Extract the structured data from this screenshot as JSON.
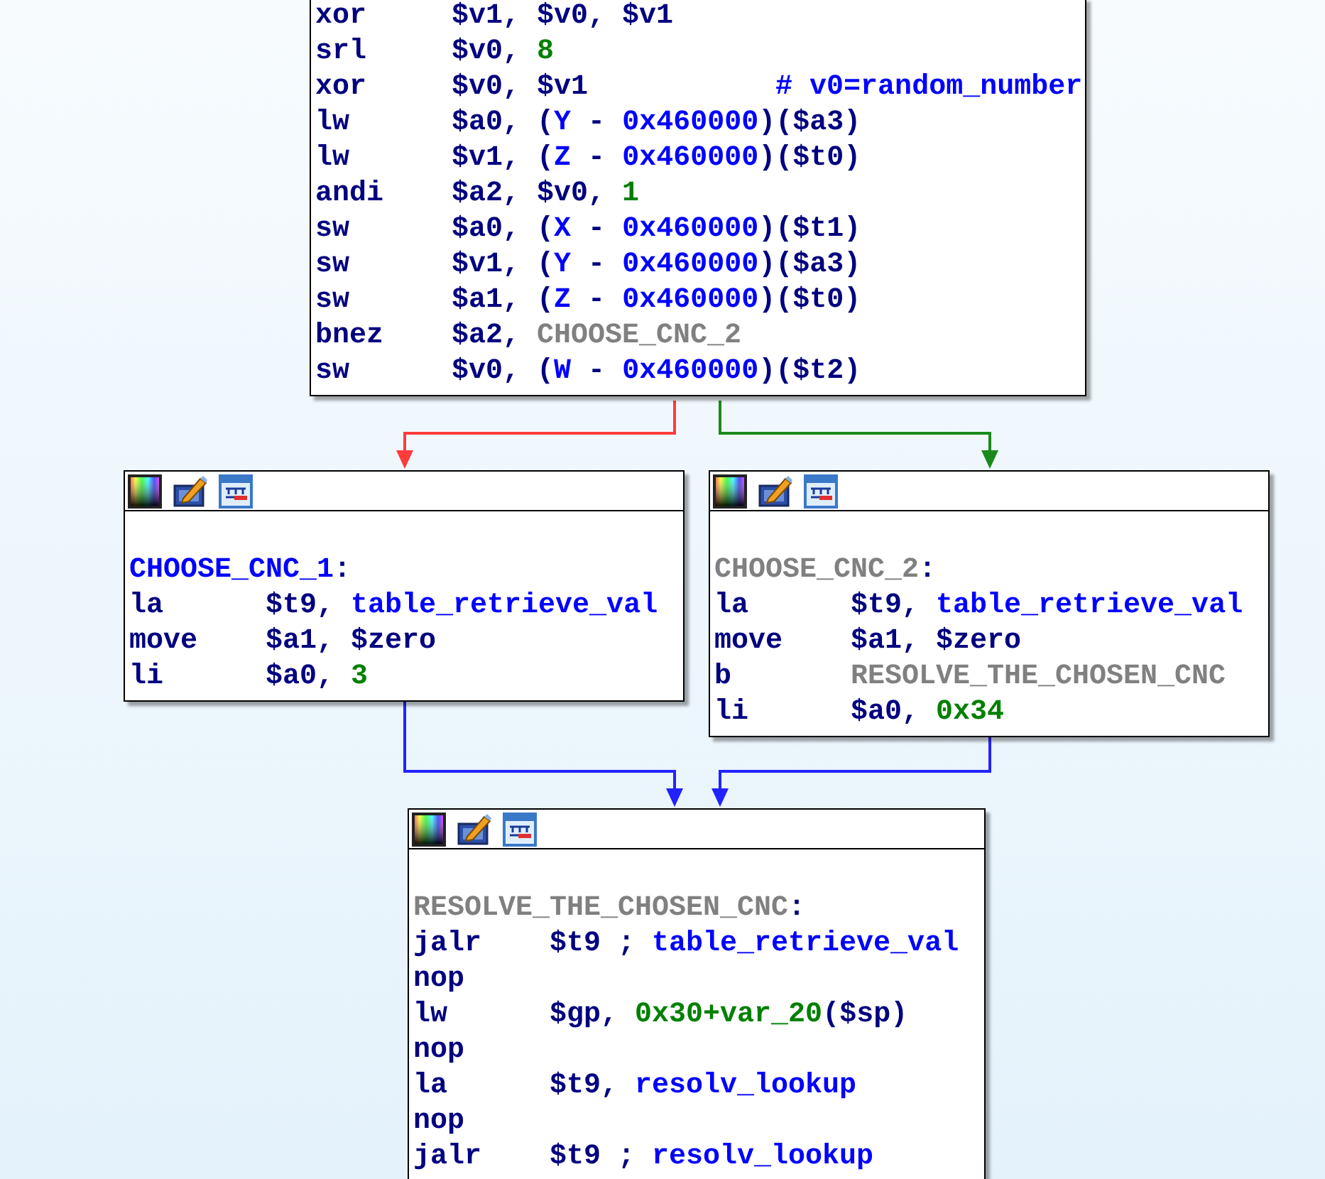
{
  "blocks": [
    {
      "toolbar": false,
      "lines": [
        {
          "op": "xor",
          "tokens": [
            {
              "kind": "reg",
              "text": "$v1, $v0, $v1"
            }
          ]
        },
        {
          "op": "srl",
          "tokens": [
            {
              "kind": "reg",
              "text": "$v0, "
            },
            {
              "kind": "num",
              "text": "8"
            }
          ]
        },
        {
          "op": "xor",
          "tokens": [
            {
              "kind": "reg",
              "text": "$v0, $v1"
            }
          ],
          "comment": "# v0=random_number"
        },
        {
          "op": "lw",
          "tokens": [
            {
              "kind": "reg",
              "text": "$a0, ("
            },
            {
              "kind": "name",
              "text": "Y"
            },
            {
              "kind": "reg",
              "text": " - "
            },
            {
              "kind": "name",
              "text": "0x460000"
            },
            {
              "kind": "reg",
              "text": ")($a3)"
            }
          ]
        },
        {
          "op": "lw",
          "tokens": [
            {
              "kind": "reg",
              "text": "$v1, ("
            },
            {
              "kind": "name",
              "text": "Z"
            },
            {
              "kind": "reg",
              "text": " - "
            },
            {
              "kind": "name",
              "text": "0x460000"
            },
            {
              "kind": "reg",
              "text": ")($t0)"
            }
          ]
        },
        {
          "op": "andi",
          "tokens": [
            {
              "kind": "reg",
              "text": "$a2, $v0, "
            },
            {
              "kind": "num",
              "text": "1"
            }
          ]
        },
        {
          "op": "sw",
          "tokens": [
            {
              "kind": "reg",
              "text": "$a0, ("
            },
            {
              "kind": "name",
              "text": "X"
            },
            {
              "kind": "reg",
              "text": " - "
            },
            {
              "kind": "name",
              "text": "0x460000"
            },
            {
              "kind": "reg",
              "text": ")($t1)"
            }
          ]
        },
        {
          "op": "sw",
          "tokens": [
            {
              "kind": "reg",
              "text": "$v1, ("
            },
            {
              "kind": "name",
              "text": "Y"
            },
            {
              "kind": "reg",
              "text": " - "
            },
            {
              "kind": "name",
              "text": "0x460000"
            },
            {
              "kind": "reg",
              "text": ")($a3)"
            }
          ]
        },
        {
          "op": "sw",
          "tokens": [
            {
              "kind": "reg",
              "text": "$a1, ("
            },
            {
              "kind": "name",
              "text": "Z"
            },
            {
              "kind": "reg",
              "text": " - "
            },
            {
              "kind": "name",
              "text": "0x460000"
            },
            {
              "kind": "reg",
              "text": ")($t0)"
            }
          ]
        },
        {
          "op": "bnez",
          "tokens": [
            {
              "kind": "reg",
              "text": "$a2, "
            },
            {
              "kind": "label",
              "text": "CHOOSE_CNC_2"
            }
          ]
        },
        {
          "op": "sw",
          "tokens": [
            {
              "kind": "reg",
              "text": "$v0, ("
            },
            {
              "kind": "name",
              "text": "W"
            },
            {
              "kind": "reg",
              "text": " - "
            },
            {
              "kind": "name",
              "text": "0x460000"
            },
            {
              "kind": "reg",
              "text": ")($t2)"
            }
          ]
        }
      ]
    },
    {
      "toolbar": true,
      "lines": [
        {
          "tokens": [
            {
              "kind": "name",
              "text": "CHOOSE_CNC_1"
            },
            {
              "kind": "reg",
              "text": ":"
            }
          ]
        },
        {
          "op": "la",
          "tokens": [
            {
              "kind": "reg",
              "text": "$t9, "
            },
            {
              "kind": "name",
              "text": "table_retrieve_val"
            }
          ]
        },
        {
          "op": "move",
          "tokens": [
            {
              "kind": "reg",
              "text": "$a1, $zero"
            }
          ]
        },
        {
          "op": "li",
          "tokens": [
            {
              "kind": "reg",
              "text": "$a0, "
            },
            {
              "kind": "num",
              "text": "3"
            }
          ]
        }
      ]
    },
    {
      "toolbar": true,
      "lines": [
        {
          "tokens": [
            {
              "kind": "label",
              "text": "CHOOSE_CNC_2"
            },
            {
              "kind": "reg",
              "text": ":"
            }
          ]
        },
        {
          "op": "la",
          "tokens": [
            {
              "kind": "reg",
              "text": "$t9, "
            },
            {
              "kind": "name",
              "text": "table_retrieve_val"
            }
          ]
        },
        {
          "op": "move",
          "tokens": [
            {
              "kind": "reg",
              "text": "$a1, $zero"
            }
          ]
        },
        {
          "op": "b",
          "tokens": [
            {
              "kind": "label",
              "text": "RESOLVE_THE_CHOSEN_CNC"
            }
          ]
        },
        {
          "op": "li",
          "tokens": [
            {
              "kind": "reg",
              "text": "$a0, "
            },
            {
              "kind": "num",
              "text": "0x34"
            }
          ]
        }
      ]
    },
    {
      "toolbar": true,
      "lines": [
        {
          "tokens": [
            {
              "kind": "label",
              "text": "RESOLVE_THE_CHOSEN_CNC"
            },
            {
              "kind": "reg",
              "text": ":"
            }
          ]
        },
        {
          "op": "jalr",
          "tokens": [
            {
              "kind": "reg",
              "text": "$t9 ; "
            },
            {
              "kind": "name",
              "text": "table_retrieve_val"
            }
          ]
        },
        {
          "op": "nop"
        },
        {
          "op": "lw",
          "tokens": [
            {
              "kind": "reg",
              "text": "$gp, "
            },
            {
              "kind": "num",
              "text": "0x30+var_20"
            },
            {
              "kind": "reg",
              "text": "($sp)"
            }
          ]
        },
        {
          "op": "nop"
        },
        {
          "op": "la",
          "tokens": [
            {
              "kind": "reg",
              "text": "$t9, "
            },
            {
              "kind": "name",
              "text": "resolv_lookup"
            }
          ]
        },
        {
          "op": "nop"
        },
        {
          "op": "jalr",
          "tokens": [
            {
              "kind": "reg",
              "text": "$t9 ; "
            },
            {
              "kind": "name",
              "text": "resolv_lookup"
            }
          ]
        }
      ]
    }
  ],
  "edges": [
    {
      "color": "#ff3b3b"
    },
    {
      "color": "#1a8a1a"
    },
    {
      "color": "#2222ff"
    },
    {
      "color": "#2222ff"
    }
  ]
}
